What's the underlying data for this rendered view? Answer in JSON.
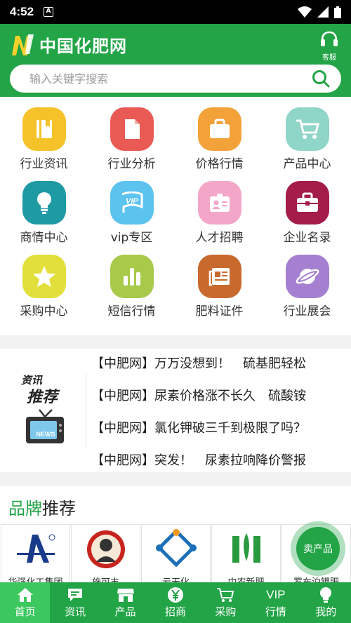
{
  "status": {
    "time": "4:52"
  },
  "header": {
    "title": "中国化肥网",
    "service_label": "客服"
  },
  "search": {
    "placeholder": "输入关键字搜索"
  },
  "grid": [
    {
      "label": "行业资讯",
      "icon": "book-icon",
      "color": "#f5c22a"
    },
    {
      "label": "行业分析",
      "icon": "document-icon",
      "color": "#ea5a54"
    },
    {
      "label": "价格行情",
      "icon": "briefcase-icon",
      "color": "#f3a23a"
    },
    {
      "label": "产品中心",
      "icon": "cart-icon",
      "color": "#8fd5c8"
    },
    {
      "label": "商情中心",
      "icon": "lightbulb-icon",
      "color": "#1e9aa3"
    },
    {
      "label": "vip专区",
      "icon": "vip-flag-icon",
      "color": "#5cc3ef"
    },
    {
      "label": "人才招聘",
      "icon": "id-card-icon",
      "color": "#f3a6c8"
    },
    {
      "label": "企业名录",
      "icon": "toolbox-icon",
      "color": "#a31c4a"
    },
    {
      "label": "采购中心",
      "icon": "star-icon",
      "color": "#e2df3a"
    },
    {
      "label": "短信行情",
      "icon": "bar-chart-icon",
      "color": "#a9c94a"
    },
    {
      "label": "肥料证件",
      "icon": "newspaper-icon",
      "color": "#c86a2e"
    },
    {
      "label": "行业展会",
      "icon": "planet-icon",
      "color": "#a57fd0"
    }
  ],
  "news": {
    "badge_line1": "资讯",
    "badge_line2": "推荐",
    "badge_tv": "NEWS",
    "items": [
      "【中肥网】万万没想到！　硫基肥轻松",
      "【中肥网】尿素价格涨不长久　硫酸铵",
      "【中肥网】氯化钾破三千到极限了吗？",
      "【中肥网】突发！　尿素拉响降价警报"
    ]
  },
  "brand": {
    "title_green": "品牌",
    "title_rest": "推荐",
    "items": [
      {
        "name": "华强化工集团"
      },
      {
        "name": "施可丰"
      },
      {
        "name": "云天化"
      },
      {
        "name": "中农新肥"
      },
      {
        "name": "罗布泊钾肥"
      }
    ]
  },
  "sell_button": "卖产品",
  "tabs": [
    {
      "label": "首页",
      "icon": "home-icon",
      "active": true
    },
    {
      "label": "资讯",
      "icon": "chat-icon",
      "active": false
    },
    {
      "label": "产品",
      "icon": "shop-icon",
      "active": false
    },
    {
      "label": "招商",
      "icon": "yen-icon",
      "active": false
    },
    {
      "label": "采购",
      "icon": "cart-icon",
      "active": false
    },
    {
      "label": "VIP",
      "label2": "行情",
      "icon": "vip-text",
      "active": false
    },
    {
      "label": "我的",
      "icon": "bulb-icon",
      "active": false
    }
  ],
  "colors": {
    "primary": "#22a447",
    "tab_active": "#3cc85f"
  }
}
